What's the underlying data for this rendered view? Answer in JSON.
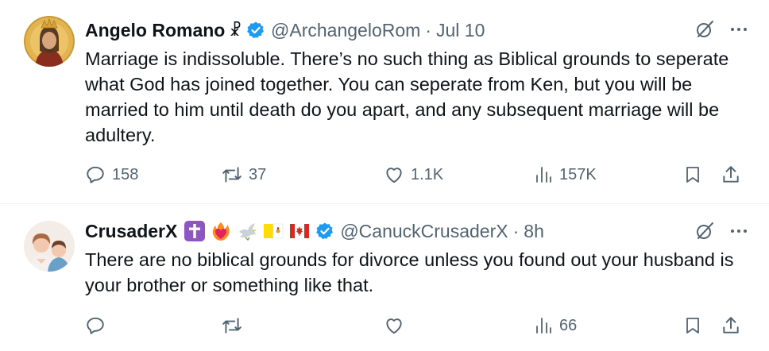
{
  "colors": {
    "text": "#0f1419",
    "secondary": "#536471",
    "verified": "#1d9bf0",
    "divider": "#eff3f4"
  },
  "tweets": [
    {
      "name": "Angelo Romano",
      "name_suffix": "☧",
      "handle": "@ArchangeloRom",
      "separator": "·",
      "time": "Jul 10",
      "body": "Marriage is indissoluble. There’s no such thing as Biblical grounds to seperate what God has joined together. You can seperate from Ken, but you will be married to him until death do you apart, and any subsequent marriage will be adultery.",
      "replies": "158",
      "retweets": "37",
      "likes": "1.1K",
      "views": "157K"
    },
    {
      "name": "CrusaderX",
      "name_emojis": [
        "latin-cross-emoji",
        "heart-on-fire-emoji",
        "dove-emoji",
        "vatican-flag-emoji",
        "canada-flag-emoji"
      ],
      "handle": "@CanuckCrusaderX",
      "separator": "·",
      "time": "8h",
      "body": "There are no biblical grounds for divorce unless you found out your husband is your brother or something like that.",
      "replies": "",
      "retweets": "",
      "likes": "",
      "views": "66"
    }
  ]
}
